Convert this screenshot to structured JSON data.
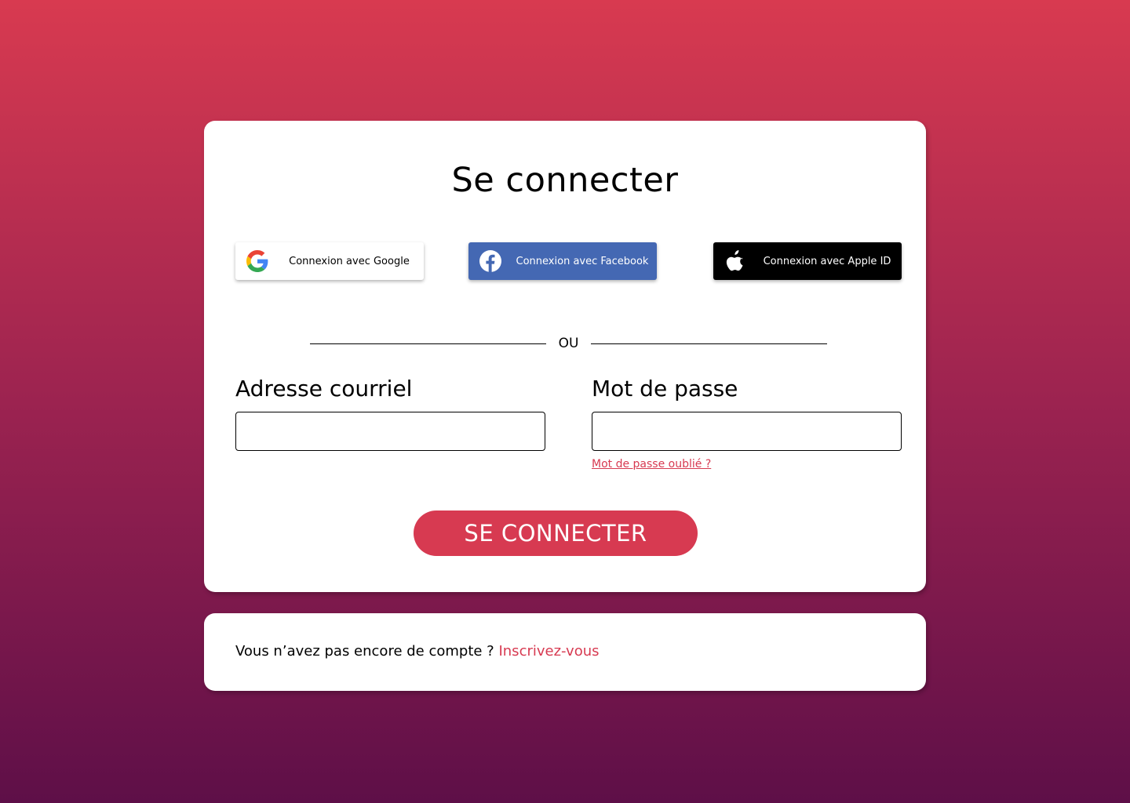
{
  "login": {
    "title": "Se connecter",
    "social": {
      "google_label": "Connexion avec Google",
      "facebook_label": "Connexion avec Facebook",
      "apple_label": "Connexion avec Apple ID"
    },
    "divider_text": "OU",
    "email": {
      "label": "Adresse courriel",
      "value": "",
      "placeholder": ""
    },
    "password": {
      "label": "Mot de passe",
      "value": "",
      "placeholder": ""
    },
    "forgot_password": "Mot de passe oublié ?",
    "submit_label": "SE CONNECTER"
  },
  "signup": {
    "prompt": "Vous n’avez pas encore de compte ? ",
    "link": "Inscrivez-vous"
  },
  "colors": {
    "accent": "#d73a51",
    "facebook": "#4468b3",
    "apple": "#000000",
    "bg_top": "#d83a50",
    "bg_bottom": "#5e0f48"
  },
  "icons": {
    "google": "google-logo-icon",
    "facebook": "facebook-logo-icon",
    "apple": "apple-logo-icon"
  }
}
